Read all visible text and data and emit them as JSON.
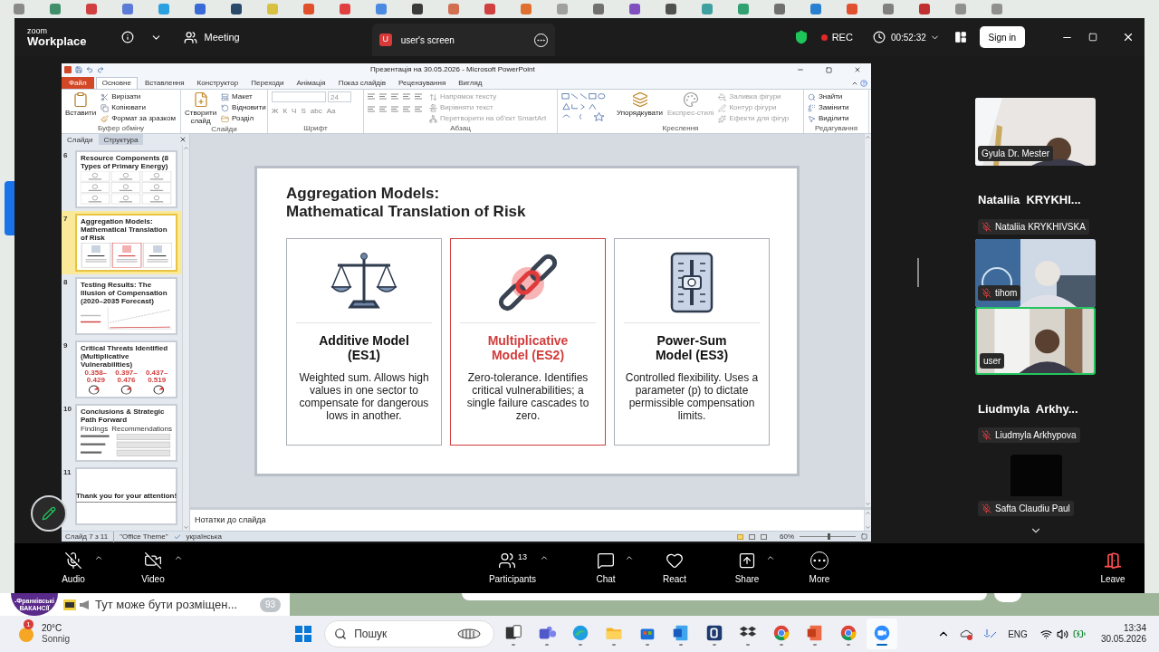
{
  "zoom": {
    "brand": {
      "top": "zoom",
      "bottom": "Workplace"
    },
    "meeting_label": "Meeting",
    "screen_tab": {
      "badge": "U",
      "title": "user's screen"
    },
    "recording": "REC",
    "timer": "00:52:32",
    "sign_in": "Sign in"
  },
  "powerpoint": {
    "title": "Презентація на 30.05.2026 - Microsoft PowerPoint",
    "file_tab": "Файл",
    "tabs": [
      {
        "label": "Основне",
        "selected": true
      },
      {
        "label": "Вставлення",
        "selected": false
      },
      {
        "label": "Конструктор",
        "selected": false
      },
      {
        "label": "Переходи",
        "selected": false
      },
      {
        "label": "Анімація",
        "selected": false
      },
      {
        "label": "Показ слайдів",
        "selected": false
      },
      {
        "label": "Рецензування",
        "selected": false
      },
      {
        "label": "Вигляд",
        "selected": false
      }
    ],
    "ribbon": [
      {
        "kind": "buttons",
        "label": "Буфер обміну",
        "large": [
          {
            "label": "Вставити",
            "disabled": false
          }
        ],
        "small": [
          {
            "label": "Вирізати",
            "disabled": false
          },
          {
            "label": "Копіювати",
            "disabled": false
          },
          {
            "label": "Формат за зразком",
            "disabled": false
          }
        ]
      },
      {
        "kind": "buttons",
        "label": "Слайди",
        "large": [
          {
            "label": "Створити слайд",
            "disabled": false
          }
        ],
        "small": [
          {
            "label": "Макет",
            "disabled": false
          },
          {
            "label": "Відновити",
            "disabled": false
          },
          {
            "label": "Розділ",
            "disabled": false
          }
        ]
      },
      {
        "kind": "font",
        "label": "Шрифт",
        "font_size": "24",
        "glyphs": [
          "Ж",
          "К",
          "Ч",
          "S",
          "abc",
          "Aa"
        ]
      },
      {
        "kind": "paragraph",
        "label": "Абзац",
        "small": [
          {
            "label": "Напрямок тексту",
            "disabled": true
          },
          {
            "label": "Вирівняти текст",
            "disabled": true
          },
          {
            "label": "Перетворити на об'єкт SmartArt",
            "disabled": true
          }
        ]
      },
      {
        "kind": "drawing",
        "label": "Креслення",
        "large": [
          {
            "label": "Упорядкувати",
            "disabled": false
          },
          {
            "label": "Експрес-стилі",
            "disabled": true
          }
        ],
        "small": [
          {
            "label": "Заливка фігури",
            "disabled": true
          },
          {
            "label": "Контур фігури",
            "disabled": true
          },
          {
            "label": "Ефекти для фігур",
            "disabled": true
          }
        ]
      },
      {
        "kind": "buttons",
        "label": "Редагування",
        "small": [
          {
            "label": "Знайти",
            "disabled": false
          },
          {
            "label": "Замінити",
            "disabled": false
          },
          {
            "label": "Виділити",
            "disabled": false
          }
        ]
      }
    ],
    "pane_tabs": [
      {
        "label": "Слайди",
        "selected": true
      },
      {
        "label": "Структура",
        "selected": false
      }
    ],
    "thumbnails": [
      {
        "number": "6",
        "selected": false,
        "kind": "grid",
        "title": "Resource Components (8 Types of Primary Energy)"
      },
      {
        "number": "7",
        "selected": true,
        "kind": "cards",
        "title": "Aggregation Models: Mathematical Translation of Risk"
      },
      {
        "number": "8",
        "selected": false,
        "kind": "chart",
        "title": "Testing Results: The Illusion of Compensation (2020–2035 Forecast)"
      },
      {
        "number": "9",
        "selected": false,
        "kind": "gauges",
        "title": "Critical Threats Identified (Multiplicative Vulnerabilities)",
        "values": [
          "0.358–0.429",
          "0.397–0.476",
          "0.437–0.519"
        ]
      },
      {
        "number": "10",
        "selected": false,
        "kind": "two_column",
        "title": "Conclusions & Strategic Path Forward",
        "columns": [
          "Findings",
          "Recommendations"
        ]
      },
      {
        "number": "11",
        "selected": false,
        "kind": "closing",
        "title": "Thank you for your attention!"
      }
    ],
    "slide": {
      "title": "Aggregation Models:\nMathematical Translation of Risk",
      "cards": [
        {
          "kind": "scales",
          "heading": "Additive Model\n(ES1)",
          "body": "Weighted sum. Allows high values in one sector to compensate for dangerous lows in another.",
          "highlighted": false
        },
        {
          "kind": "chain",
          "heading": "Multiplicative\nModel (ES2)",
          "body": "Zero-tolerance. Identifies critical vulnerabilities; a single failure cascades to zero.",
          "highlighted": true
        },
        {
          "kind": "slider",
          "heading": "Power-Sum\nModel (ES3)",
          "body": "Controlled flexibility. Uses a parameter (p) to dictate permissible compensation limits.",
          "highlighted": false
        }
      ]
    },
    "notes": {
      "placeholder": "Нотатки до слайда"
    },
    "status": {
      "slide": "Слайд 7 з 11",
      "theme": "\"Office Theme\"",
      "language": "українська",
      "zoom": "60%",
      "zoom_slider": {
        "level": 0.5
      }
    }
  },
  "participants": [
    {
      "kind": "video",
      "name": "Gyula Dr. Mester",
      "muted": false,
      "speaking": false
    },
    {
      "kind": "name",
      "heading": "Nataliia  KRYKHI...",
      "name": "Nataliia KRYKHIVSKA",
      "muted": true
    },
    {
      "kind": "video",
      "name": "tihom",
      "muted": true,
      "speaking": false
    },
    {
      "kind": "video",
      "name": "user",
      "muted": false,
      "speaking": true
    },
    {
      "kind": "name",
      "heading": "Liudmyla  Arkhy...",
      "name": "Liudmyla Arkhypova",
      "muted": true
    },
    {
      "kind": "blank",
      "name": "Safta Claudiu Paul",
      "muted": true
    }
  ],
  "toolbar": [
    {
      "kind": "mic",
      "label": "Audio",
      "off": true,
      "caret": true
    },
    {
      "kind": "video",
      "label": "Video",
      "off": true,
      "caret": true
    },
    {
      "kind": "people",
      "label": "Participants",
      "count": "13",
      "off": false,
      "caret": true
    },
    {
      "kind": "chat",
      "label": "Chat",
      "off": false,
      "caret": true
    },
    {
      "kind": "heart",
      "label": "React",
      "off": false,
      "caret": false
    },
    {
      "kind": "share",
      "label": "Share",
      "off": false,
      "caret": true
    },
    {
      "kind": "more",
      "label": "More",
      "off": false,
      "caret": false
    }
  ],
  "leave": {
    "label": "Leave"
  },
  "chat_preview": {
    "avatar_lines": [
      "-Франківські",
      "ВАКАНСІЇ"
    ],
    "message": "Тут може бути розміщен...",
    "unread": "93"
  },
  "taskbar": {
    "weather": {
      "badge": "1",
      "temperature": "20°C",
      "condition": "Sonnig"
    },
    "search_placeholder": "Пошук",
    "apps": [
      {
        "kind": "task_view",
        "active": false
      },
      {
        "kind": "teams",
        "active": false
      },
      {
        "kind": "edge",
        "active": false
      },
      {
        "kind": "explorer",
        "active": false
      },
      {
        "kind": "store",
        "active": false
      },
      {
        "kind": "word",
        "active": false
      },
      {
        "kind": "b_app",
        "active": false
      },
      {
        "kind": "dropbox",
        "active": false
      },
      {
        "kind": "chrome",
        "active": false
      },
      {
        "kind": "powerpoint",
        "active": false
      },
      {
        "kind": "chrome",
        "active": false
      },
      {
        "kind": "zoom",
        "active": true
      }
    ],
    "language": "ENG",
    "time": "13:34",
    "date": "30.05.2026"
  }
}
